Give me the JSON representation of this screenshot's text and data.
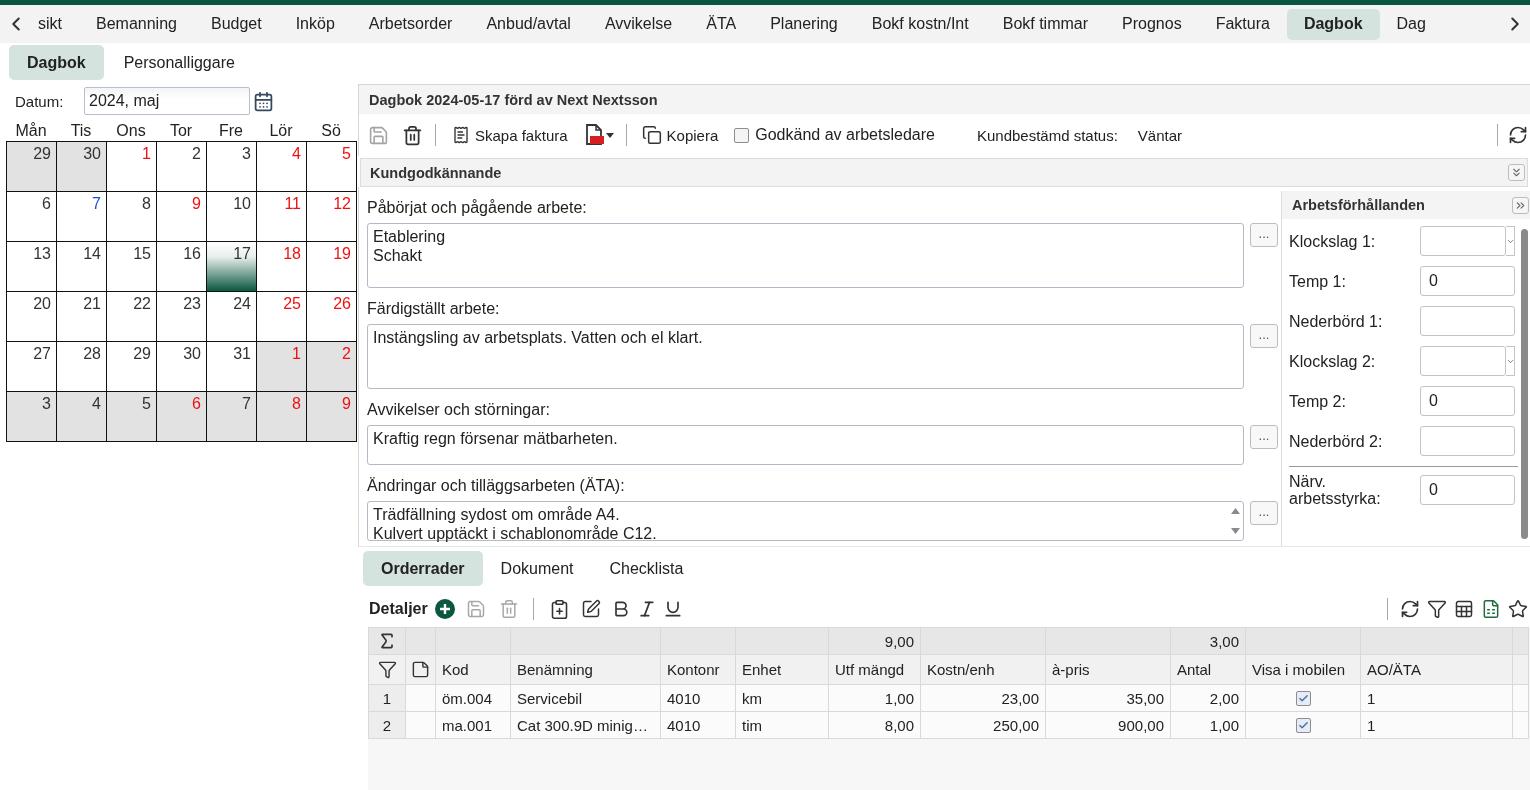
{
  "top_tabs": [
    {
      "label": "sikt",
      "selected": false
    },
    {
      "label": "Bemanning",
      "selected": false
    },
    {
      "label": "Budget",
      "selected": false
    },
    {
      "label": "Inköp",
      "selected": false
    },
    {
      "label": "Arbetsorder",
      "selected": false
    },
    {
      "label": "Anbud/avtal",
      "selected": false
    },
    {
      "label": "Avvikelse",
      "selected": false
    },
    {
      "label": "ÄTA",
      "selected": false
    },
    {
      "label": "Planering",
      "selected": false
    },
    {
      "label": "Bokf kostn/Int",
      "selected": false
    },
    {
      "label": "Bokf timmar",
      "selected": false
    },
    {
      "label": "Prognos",
      "selected": false
    },
    {
      "label": "Faktura",
      "selected": false
    },
    {
      "label": "Dagbok",
      "selected": true
    },
    {
      "label": "Dag",
      "selected": false
    }
  ],
  "sub_tabs": [
    {
      "label": "Dagbok",
      "selected": true
    },
    {
      "label": "Personalliggare",
      "selected": false
    }
  ],
  "calendar": {
    "date_label": "Datum:",
    "date_value": "2024, maj",
    "weekdays": [
      "Mån",
      "Tis",
      "Ons",
      "Tor",
      "Fre",
      "Lör",
      "Sö"
    ],
    "days": [
      {
        "day": "29",
        "in_month": false,
        "color": "#333333",
        "selected": false
      },
      {
        "day": "30",
        "in_month": false,
        "color": "#333333",
        "selected": false
      },
      {
        "day": "1",
        "in_month": true,
        "color": "#ee1111",
        "selected": false
      },
      {
        "day": "2",
        "in_month": true,
        "color": "#333333",
        "selected": false
      },
      {
        "day": "3",
        "in_month": true,
        "color": "#333333",
        "selected": false
      },
      {
        "day": "4",
        "in_month": true,
        "color": "#ee1111",
        "selected": false
      },
      {
        "day": "5",
        "in_month": true,
        "color": "#ee1111",
        "selected": false
      },
      {
        "day": "6",
        "in_month": true,
        "color": "#333333",
        "selected": false
      },
      {
        "day": "7",
        "in_month": true,
        "color": "#1d4ed8",
        "selected": false
      },
      {
        "day": "8",
        "in_month": true,
        "color": "#333333",
        "selected": false
      },
      {
        "day": "9",
        "in_month": true,
        "color": "#ee1111",
        "selected": false
      },
      {
        "day": "10",
        "in_month": true,
        "color": "#333333",
        "selected": false
      },
      {
        "day": "11",
        "in_month": true,
        "color": "#ee1111",
        "selected": false
      },
      {
        "day": "12",
        "in_month": true,
        "color": "#ee1111",
        "selected": false
      },
      {
        "day": "13",
        "in_month": true,
        "color": "#333333",
        "selected": false
      },
      {
        "day": "14",
        "in_month": true,
        "color": "#333333",
        "selected": false
      },
      {
        "day": "15",
        "in_month": true,
        "color": "#333333",
        "selected": false
      },
      {
        "day": "16",
        "in_month": true,
        "color": "#333333",
        "selected": false
      },
      {
        "day": "17",
        "in_month": true,
        "color": "#333333",
        "selected": true
      },
      {
        "day": "18",
        "in_month": true,
        "color": "#ee1111",
        "selected": false
      },
      {
        "day": "19",
        "in_month": true,
        "color": "#ee1111",
        "selected": false
      },
      {
        "day": "20",
        "in_month": true,
        "color": "#333333",
        "selected": false
      },
      {
        "day": "21",
        "in_month": true,
        "color": "#333333",
        "selected": false
      },
      {
        "day": "22",
        "in_month": true,
        "color": "#333333",
        "selected": false
      },
      {
        "day": "23",
        "in_month": true,
        "color": "#333333",
        "selected": false
      },
      {
        "day": "24",
        "in_month": true,
        "color": "#333333",
        "selected": false
      },
      {
        "day": "25",
        "in_month": true,
        "color": "#ee1111",
        "selected": false
      },
      {
        "day": "26",
        "in_month": true,
        "color": "#ee1111",
        "selected": false
      },
      {
        "day": "27",
        "in_month": true,
        "color": "#333333",
        "selected": false
      },
      {
        "day": "28",
        "in_month": true,
        "color": "#333333",
        "selected": false
      },
      {
        "day": "29",
        "in_month": true,
        "color": "#333333",
        "selected": false
      },
      {
        "day": "30",
        "in_month": true,
        "color": "#333333",
        "selected": false
      },
      {
        "day": "31",
        "in_month": true,
        "color": "#333333",
        "selected": false
      },
      {
        "day": "1",
        "in_month": false,
        "color": "#ee1111",
        "selected": false
      },
      {
        "day": "2",
        "in_month": false,
        "color": "#ee1111",
        "selected": false
      },
      {
        "day": "3",
        "in_month": false,
        "color": "#333333",
        "selected": false
      },
      {
        "day": "4",
        "in_month": false,
        "color": "#333333",
        "selected": false
      },
      {
        "day": "5",
        "in_month": false,
        "color": "#333333",
        "selected": false
      },
      {
        "day": "6",
        "in_month": false,
        "color": "#ee1111",
        "selected": false
      },
      {
        "day": "7",
        "in_month": false,
        "color": "#333333",
        "selected": false
      },
      {
        "day": "8",
        "in_month": false,
        "color": "#ee1111",
        "selected": false
      },
      {
        "day": "9",
        "in_month": false,
        "color": "#ee1111",
        "selected": false
      }
    ]
  },
  "diary": {
    "title": "Dagbok 2024-05-17 förd av Next Nextsson",
    "toolbar": {
      "save_disabled": true,
      "create_invoice": "Skapa faktura",
      "copy": "Kopiera",
      "approved": {
        "label": "Godkänd av arbetsledare",
        "checked": false
      },
      "status_label": "Kundbestämd status:",
      "status_value": "Väntar"
    },
    "section_title": "Kundgodkännande",
    "fields": [
      {
        "label": "Påbörjat och pågående arbete:",
        "value": "Etablering\nSchakt",
        "kind": "large",
        "button": "..."
      },
      {
        "label": "Färdigställt arbete:",
        "value": "Instängsling av arbetsplats. Vatten och el klart.",
        "kind": "large",
        "button": "..."
      },
      {
        "label": "Avvikelser och störningar:",
        "value": "Kraftig regn försenar mätbarheten.",
        "kind": "small",
        "button": "..."
      },
      {
        "label": "Ändringar och tilläggsarbeten (ÄTA):",
        "value": "Trädfällning sydost om område A4.\nKulvert upptäckt i schablonområde C12.",
        "kind": "scrolling",
        "button": "..."
      }
    ],
    "conditions": {
      "title": "Arbetsförhållanden",
      "groups": [
        {
          "fields": [
            {
              "label": "Klockslag 1:",
              "kind": "time"
            },
            {
              "label": "Temp 1:",
              "kind": "text",
              "value": "0"
            },
            {
              "label": "Nederbörd 1:",
              "kind": "text"
            },
            {
              "label": "Klockslag 2:",
              "kind": "time"
            },
            {
              "label": "Temp 2:",
              "kind": "text",
              "value": "0"
            },
            {
              "label": "Nederbörd 2:",
              "kind": "text"
            }
          ]
        },
        {
          "fields": [
            {
              "label": "Närv. arbetsstyrka:",
              "kind": "text",
              "value": "0"
            }
          ]
        }
      ]
    }
  },
  "order_tabs": [
    {
      "label": "Orderrader",
      "selected": true
    },
    {
      "label": "Dokument",
      "selected": false
    },
    {
      "label": "Checklista",
      "selected": false
    }
  ],
  "details": {
    "title": "Detaljer",
    "save_disabled": true,
    "delete_disabled": true,
    "columns": [
      {
        "label": "Kod",
        "kind": "text"
      },
      {
        "label": "Benämning",
        "kind": "text"
      },
      {
        "label": "Kontonr",
        "kind": "text"
      },
      {
        "label": "Enhet",
        "kind": "text"
      },
      {
        "label": "Utf mängd",
        "kind": "number",
        "total": "9,00"
      },
      {
        "label": "Kostn/enh",
        "kind": "number"
      },
      {
        "label": "à-pris",
        "kind": "number"
      },
      {
        "label": "Antal",
        "kind": "number",
        "total": "3,00"
      },
      {
        "label": "Visa i mobilen",
        "kind": "check"
      },
      {
        "label": "AO/ÄTA",
        "kind": "text"
      }
    ],
    "rows": [
      {
        "number": "1",
        "cells": [
          "öm.004",
          "Servicebil",
          "4010",
          "km",
          "1,00",
          "23,00",
          "35,00",
          "2,00",
          {
            "checked": true
          },
          "1"
        ]
      },
      {
        "number": "2",
        "cells": [
          "ma.001",
          "Cat 300.9D minig…",
          "4010",
          "tim",
          "8,00",
          "250,00",
          "900,00",
          "1,00",
          {
            "checked": true
          },
          "1"
        ]
      }
    ]
  }
}
